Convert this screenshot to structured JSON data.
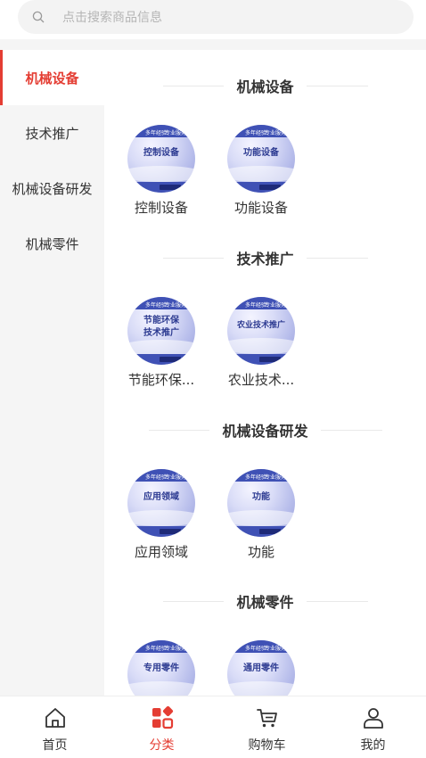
{
  "search": {
    "placeholder": "点击搜索商品信息"
  },
  "sidebar": {
    "items": [
      {
        "label": "机械设备",
        "active": true
      },
      {
        "label": "技术推广",
        "active": false
      },
      {
        "label": "机械设备研发",
        "active": false
      },
      {
        "label": "机械零件",
        "active": false
      }
    ]
  },
  "sections": [
    {
      "title": "机械设备",
      "items": [
        {
          "label": "控制设备",
          "thumb_text": "控制设备"
        },
        {
          "label": "功能设备",
          "thumb_text": "功能设备"
        }
      ]
    },
    {
      "title": "技术推广",
      "items": [
        {
          "label": "节能环保...",
          "thumb_text": "节能环保\n技术推广"
        },
        {
          "label": "农业技术...",
          "thumb_text": "农业技术推广"
        }
      ]
    },
    {
      "title": "机械设备研发",
      "items": [
        {
          "label": "应用领域",
          "thumb_text": "应用领域"
        },
        {
          "label": "功能",
          "thumb_text": "功能"
        }
      ]
    },
    {
      "title": "机械零件",
      "items": [
        {
          "label": "",
          "thumb_text": "专用零件"
        },
        {
          "label": "",
          "thumb_text": "通用零件"
        }
      ]
    }
  ],
  "tabbar": {
    "items": [
      {
        "label": "首页",
        "icon": "home-icon",
        "active": false
      },
      {
        "label": "分类",
        "icon": "category-icon",
        "active": true
      },
      {
        "label": "购物车",
        "icon": "cart-icon",
        "active": false
      },
      {
        "label": "我的",
        "icon": "user-icon",
        "active": false
      }
    ]
  },
  "colors": {
    "accent": "#e43d33",
    "thumb_blue": "#3f51b5"
  }
}
